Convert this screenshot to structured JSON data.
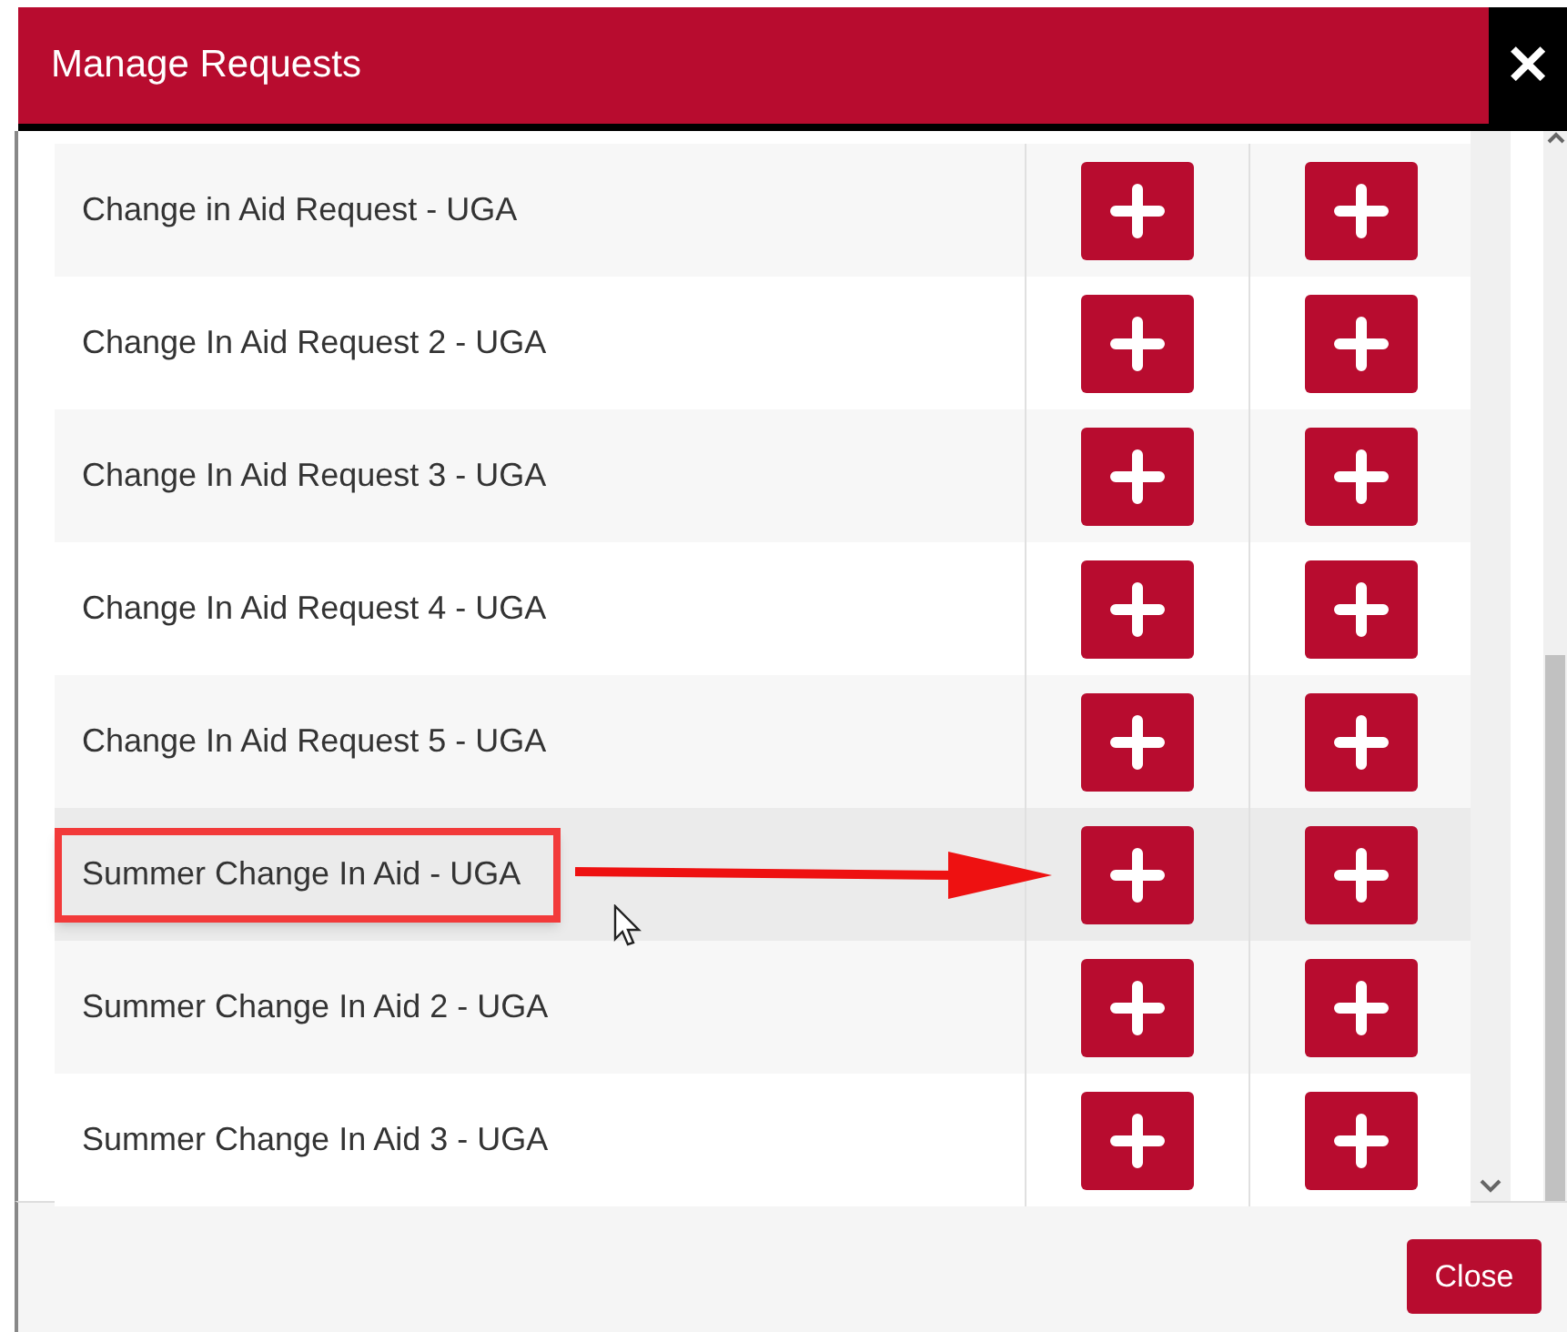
{
  "dialog": {
    "title": "Manage Requests",
    "close_icon": "✕"
  },
  "rows": [
    {
      "name": "Change in Aid Request - UGA",
      "highlighted": false
    },
    {
      "name": "Change In Aid Request 2 - UGA",
      "highlighted": false
    },
    {
      "name": "Change In Aid Request 3 - UGA",
      "highlighted": false
    },
    {
      "name": "Change In Aid Request 4 - UGA",
      "highlighted": false
    },
    {
      "name": "Change In Aid Request 5 - UGA",
      "highlighted": false
    },
    {
      "name": "Summer Change In Aid - UGA",
      "highlighted": true
    },
    {
      "name": "Summer Change In Aid 2 - UGA",
      "highlighted": false
    },
    {
      "name": "Summer Change In Aid 3 - UGA",
      "highlighted": false
    }
  ],
  "footer": {
    "button": "Close"
  }
}
